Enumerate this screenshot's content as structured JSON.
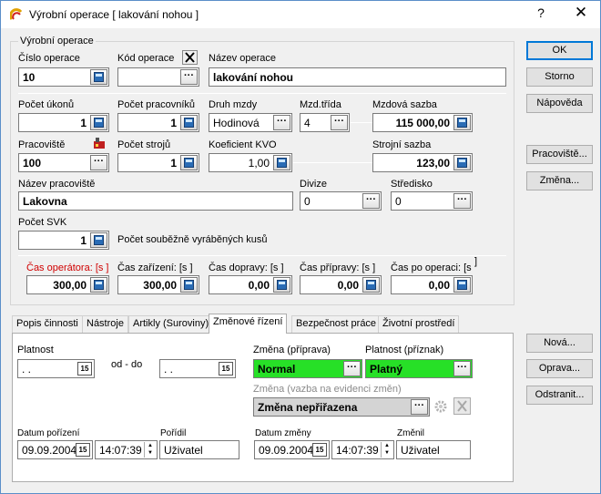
{
  "window": {
    "title": "Výrobní operace [ lakování nohou ]",
    "help": "?",
    "close": "✕"
  },
  "group_title": "Výrobní operace",
  "fields": {
    "cislo_operace": {
      "label": "Číslo operace",
      "value": "10"
    },
    "kod_operace": {
      "label": "Kód operace",
      "value": ""
    },
    "nazev_operace": {
      "label": "Název operace",
      "value": "lakování nohou"
    },
    "pocet_ukonu": {
      "label": "Počet úkonů",
      "value": "1"
    },
    "pocet_pracovniku": {
      "label": "Počet pracovníků",
      "value": "1"
    },
    "druh_mzdy": {
      "label": "Druh mzdy",
      "value": "Hodinová"
    },
    "mzd_trida": {
      "label": "Mzd.třída",
      "value": "4"
    },
    "mzdova_sazba": {
      "label": "Mzdová sazba",
      "value": "115 000,00"
    },
    "pracoviste": {
      "label": "Pracoviště",
      "value": "100"
    },
    "pocet_stroju": {
      "label": "Počet strojů",
      "value": "1"
    },
    "koeficient_kvo": {
      "label": "Koeficient KVO",
      "value": "1,00"
    },
    "strojni_sazba": {
      "label": "Strojní sazba",
      "value": "123,00"
    },
    "nazev_pracoviste": {
      "label": "Název pracoviště",
      "value": "Lakovna"
    },
    "divize": {
      "label": "Divize",
      "value": "0"
    },
    "stredisko": {
      "label": "Středisko",
      "value": "0"
    },
    "pocet_svk": {
      "label": "Počet SVK",
      "value": "1",
      "hint": "Počet souběžně vyráběných kusů"
    },
    "cas_operatora": {
      "label": "Čas operátora: [s ]",
      "value": "300,00"
    },
    "cas_zarizeni": {
      "label": "Čas zařízení: [s ]",
      "value": "300,00"
    },
    "cas_dopravy": {
      "label": "Čas dopravy: [s ]",
      "value": "0,00"
    },
    "cas_pripravy": {
      "label": "Čas přípravy: [s ]",
      "value": "0,00"
    },
    "cas_po_operaci": {
      "label": "Čas po operaci: [s",
      "value": "0,00"
    }
  },
  "buttons": {
    "ok": "OK",
    "storno": "Storno",
    "napoveda": "Nápověda",
    "pracoviste": "Pracoviště...",
    "zmena": "Změna...",
    "nova": "Nová...",
    "oprava": "Oprava...",
    "odstranit": "Odstranit..."
  },
  "tabs": [
    {
      "label": "Popis činnosti"
    },
    {
      "label": "Nástroje"
    },
    {
      "label": "Artikly (Suroviny)"
    },
    {
      "label": "Změnové řízení"
    },
    {
      "label": "Bezpečnost práce"
    },
    {
      "label": "Životní prostředí"
    }
  ],
  "zmeny": {
    "platnost": {
      "label": "Platnost",
      "from": " . .",
      "to": " . .",
      "range": "od - do"
    },
    "zmena_priprava": {
      "label": "Změna (příprava)",
      "value": "Normal"
    },
    "platnost_priznak": {
      "label": "Platnost (příznak)",
      "value": "Platný"
    },
    "zmena_vazba": {
      "label": "Změna (vazba na evidenci změn)",
      "value": "Změna nepřiřazena"
    },
    "datum_porizeni": {
      "label": "Datum pořízení",
      "date": "09.09.2004",
      "time": "14:07:39"
    },
    "poridil": {
      "label": "Pořídil",
      "value": "Uživatel"
    },
    "datum_zmeny": {
      "label": "Datum změny",
      "date": "09.09.2004",
      "time": "14:07:39"
    },
    "zmenil": {
      "label": "Změnil",
      "value": "Uživatel"
    }
  },
  "colors": {
    "accent": "#0078d7",
    "status_green": "#27e027",
    "red_label": "#d00000"
  }
}
